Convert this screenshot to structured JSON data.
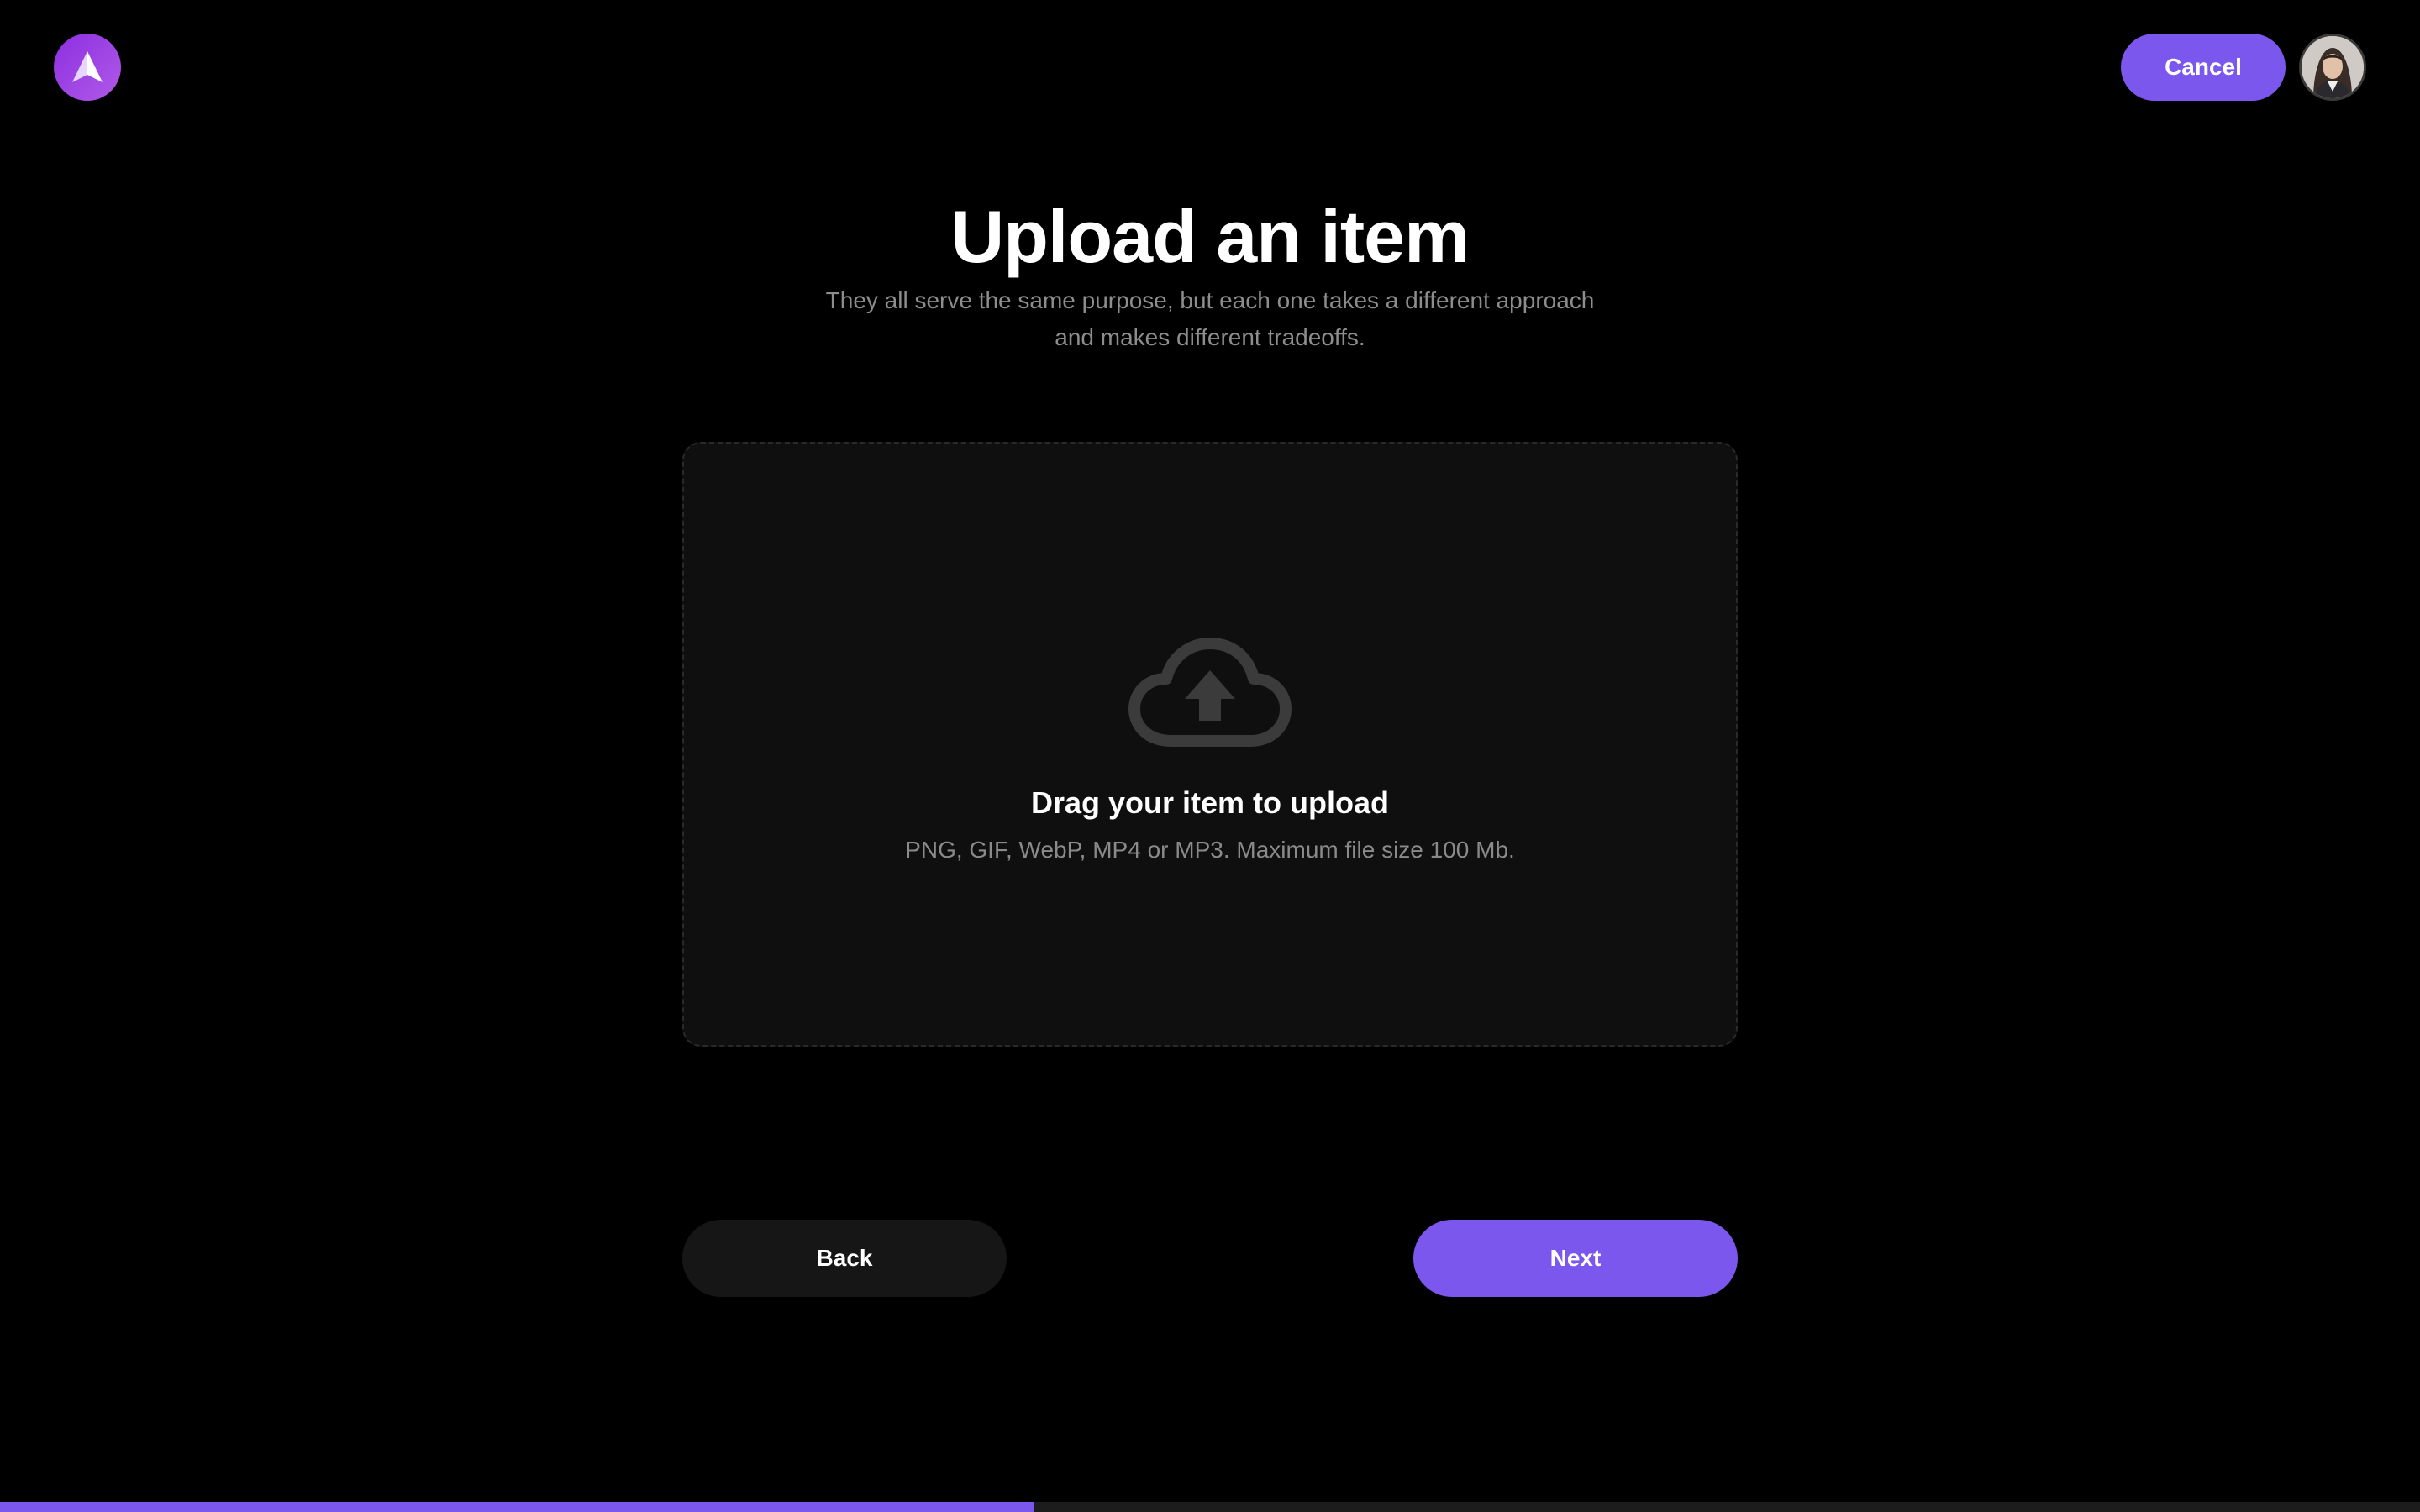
{
  "header": {
    "logo_icon": "arrow-up-logo-icon",
    "cancel_label": "Cancel",
    "avatar_icon": "user-avatar"
  },
  "main": {
    "title": "Upload an item",
    "subtitle": "They all serve the same purpose, but each one takes a different approach and makes different tradeoffs."
  },
  "dropzone": {
    "icon": "cloud-upload-icon",
    "title": "Drag your item to upload",
    "hint": "PNG, GIF, WebP, MP4 or MP3. Maximum file size 100 Mb."
  },
  "navigation": {
    "back_label": "Back",
    "next_label": "Next"
  },
  "progress": {
    "fraction": 0.427
  },
  "colors": {
    "accent": "#7b57ee",
    "background": "#000000",
    "dropzone_bg": "#0f0f0f",
    "muted_text": "#8d8d8d"
  }
}
